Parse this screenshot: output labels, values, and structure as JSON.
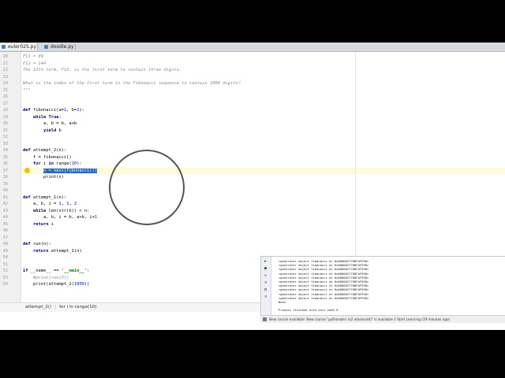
{
  "tabs": [
    {
      "label": "euler025.py",
      "active": true
    },
    {
      "label": "doodle.py",
      "active": false
    }
  ],
  "editor": {
    "line_numbers": [
      "20",
      "21",
      "22",
      "23",
      "24",
      "25",
      "26",
      "27",
      "28",
      "29",
      "30",
      "31",
      "32",
      "33",
      "34",
      "35",
      "36",
      "37",
      "38",
      "39",
      "40",
      "41",
      "42",
      "43",
      "44",
      "45",
      "46",
      "47",
      "48",
      "49",
      "50"
    ],
    "lines": [
      "F11 = 89",
      "F12 = 144",
      "The 12th term, F12, is the first term to contain three digits.",
      "",
      "What is the index of the first term in the Fibonacci sequence to contain 1000 digits?",
      "\"\"\"",
      "",
      "",
      "def fibonacci(a=1, b=1):",
      "    while True:",
      "        a, b = b, a+b",
      "        yield b",
      "",
      "",
      "def attempt_2(n):",
      "    f = fibonacci()",
      "    for i in range(10):",
      "        n = next(fibonacci())",
      "        print(n)",
      "",
      "",
      "def attempt_1(n):",
      "    a, b, i = 1, 1, 2",
      "    while len(str(b)) < n:",
      "        a, b, i = b, a+b, i+1",
      "    return i",
      "",
      "",
      "def run(n):",
      "    return attempt_1(n)",
      "",
      "",
      "if __name__ == '__main__':",
      "    #print(run(3))",
      "    print(attempt_2(1000))"
    ]
  },
  "breadcrumb": {
    "item1": "attempt_2()",
    "item2": "for i in range(10)"
  },
  "run_output": [
    "<generator object fibonacci at 0x000002770DFAF990>",
    "<generator object fibonacci at 0x000002770DFAF990>",
    "<generator object fibonacci at 0x000002770DFAF990>",
    "<generator object fibonacci at 0x000002770DFAF990>",
    "<generator object fibonacci at 0x000002770DFAF990>",
    "<generator object fibonacci at 0x000002770DFAF990>",
    "<generator object fibonacci at 0x000002770DFAF990>",
    "<generator object fibonacci at 0x000002770DFAF990>",
    "<generator object fibonacci at 0x000002770DFAF990>",
    "<generator object fibonacci at 0x000002770DFAF990>",
    "None",
    "",
    "Process finished with exit code 0"
  ],
  "status_text": "New course available: New course \"pythonator (v2 advanced)\" is available // Start Learning (19 minutes ago)",
  "colors": {
    "selection": "#2a62c9",
    "current_line": "#fffbd8",
    "keyword": "#000080",
    "string": "#008000",
    "comment": "#8c8c8c"
  },
  "icons": [
    "python-file-icon",
    "lightbulb-icon",
    "run-icon",
    "stop-icon",
    "rerun-icon",
    "status-info-icon"
  ]
}
